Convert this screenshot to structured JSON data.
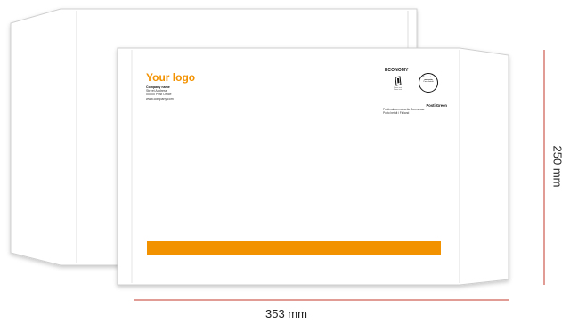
{
  "logo": {
    "text": "Your logo",
    "color": "#f39200"
  },
  "sender": {
    "company": "Company name",
    "street": "Street Address",
    "postal": "00000 Post Office",
    "web": "www.company.com"
  },
  "postage": {
    "economy_label": "ECONOMY",
    "economy_fine_1": "Some text",
    "economy_fine_2": "Some text",
    "stamp_line_1": "Postimaksu",
    "stamp_line_2": "maksettu",
    "stamp_line_3": "Porto betalt",
    "posti_green": "Posti Green",
    "fine_line_1": "Postimaksu maksettu Suomessa",
    "fine_line_2": "Porto betalt i Finland"
  },
  "bar": {
    "color": "#f39200"
  },
  "dimensions": {
    "height_label": "250 mm",
    "width_label": "353 mm",
    "line_color": "#c0392b"
  }
}
